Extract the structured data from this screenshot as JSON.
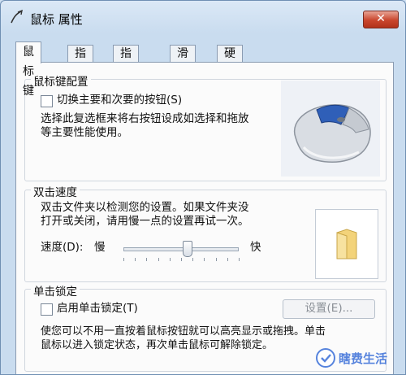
{
  "window": {
    "title": "鼠标 属性",
    "close_label": "✕"
  },
  "tabs": [
    {
      "label": "鼠标键",
      "active": true
    },
    {
      "label": "指针",
      "active": false
    },
    {
      "label": "指针选项",
      "active": false
    },
    {
      "label": "滑轮",
      "active": false
    },
    {
      "label": "硬件",
      "active": false
    }
  ],
  "button_config": {
    "legend": "鼠标键配置",
    "checkbox_label": "切换主要和次要的按钮(S)",
    "checked": false,
    "description_line1": "选择此复选框来将右按钮设成如选择和拖放",
    "description_line2": "等主要性能使用。"
  },
  "double_click": {
    "legend": "双击速度",
    "description_line1": "双击文件夹以检测您的设置。如果文件夹没",
    "description_line2": "打开或关闭，请用慢一点的设置再试一次。",
    "speed_label": "速度(D):",
    "slow_label": "慢",
    "fast_label": "快",
    "speed_value": 0.55,
    "tick_count": 11
  },
  "click_lock": {
    "legend": "单击锁定",
    "checkbox_label": "启用单击锁定(T)",
    "checked": false,
    "settings_label": "设置(E)...",
    "description_line1": "使您可以不用一直按着鼠标按钮就可以高亮显示或拖拽。单击",
    "description_line2": "鼠标以进入锁定状态，再次单击鼠标可解除锁定。"
  },
  "watermark": {
    "text": "瞎费生活"
  },
  "colors": {
    "accent": "#3a6fd8",
    "close_red": "#c9452c",
    "folder": "#f3d37a"
  }
}
